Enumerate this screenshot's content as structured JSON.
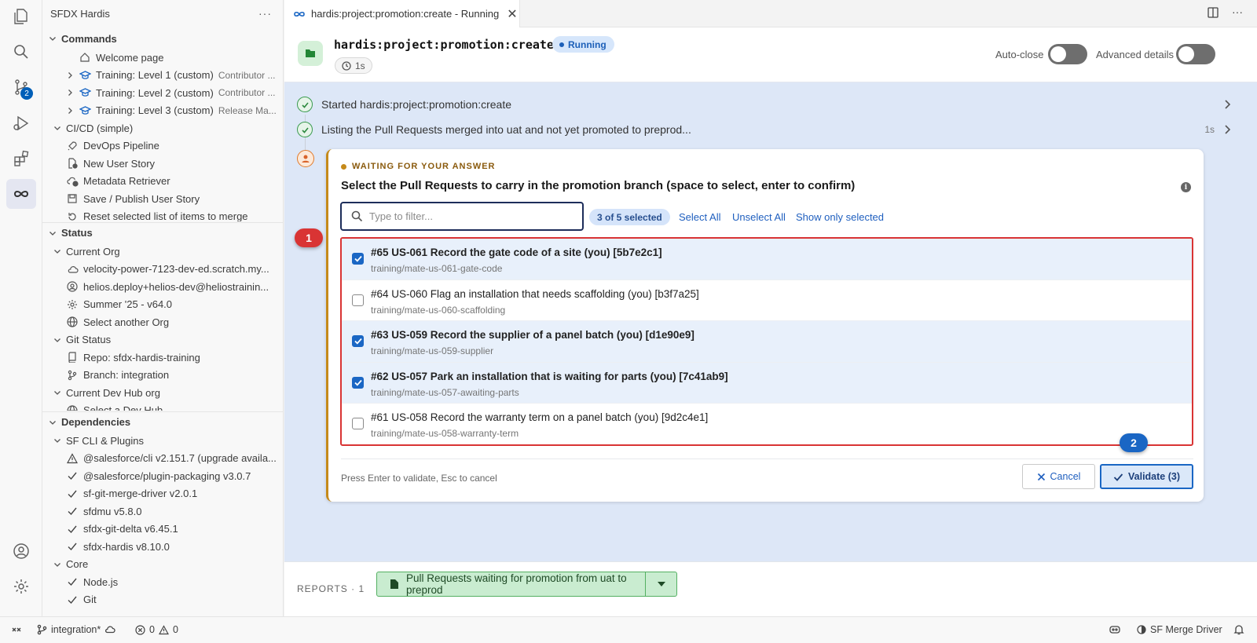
{
  "sidebar": {
    "title": "SFDX Hardis",
    "more": "···",
    "commands": {
      "header": "Commands",
      "items": [
        {
          "label": "Welcome page",
          "desc": "",
          "icon": "home-icon",
          "level": 2,
          "chevron": false
        },
        {
          "label": "Training: Level 1 (custom)",
          "desc": "Contributor ...",
          "icon": "graduation-icon",
          "level": 1,
          "chevron": true
        },
        {
          "label": "Training: Level 2 (custom)",
          "desc": "Contributor ...",
          "icon": "graduation-icon",
          "level": 1,
          "chevron": true
        },
        {
          "label": "Training: Level 3 (custom)",
          "desc": "Release Ma...",
          "icon": "graduation-icon",
          "level": 1,
          "chevron": true
        },
        {
          "label": "CI/CD (simple)",
          "desc": "",
          "icon": "",
          "level": 0,
          "chevron": true,
          "expanded": true
        },
        {
          "label": "DevOps Pipeline",
          "desc": "",
          "icon": "rocket-icon",
          "level": 1
        },
        {
          "label": "New User Story",
          "desc": "",
          "icon": "new-file-icon",
          "level": 1
        },
        {
          "label": "Metadata Retriever",
          "desc": "",
          "icon": "cloud-download-icon",
          "level": 1
        },
        {
          "label": "Save / Publish User Story",
          "desc": "",
          "icon": "save-icon",
          "level": 1
        },
        {
          "label": "Reset selected list of items to merge",
          "desc": "",
          "icon": "reset-icon",
          "level": 1
        }
      ]
    },
    "status": {
      "header": "Status",
      "items": [
        {
          "label": "Current Org",
          "icon": "",
          "level": 0,
          "chevron": true
        },
        {
          "label": "velocity-power-7123-dev-ed.scratch.my...",
          "icon": "cloud-icon",
          "level": 1
        },
        {
          "label": "helios.deploy+helios-dev@heliostrainin...",
          "icon": "account-icon",
          "level": 1
        },
        {
          "label": "Summer '25 - v64.0",
          "icon": "gear-icon",
          "level": 1
        },
        {
          "label": "Select another Org",
          "icon": "globe-icon",
          "level": 1
        },
        {
          "label": "Git Status",
          "icon": "",
          "level": 0,
          "chevron": true
        },
        {
          "label": "Repo: sfdx-hardis-training",
          "icon": "repo-icon",
          "level": 1
        },
        {
          "label": "Branch: integration",
          "icon": "branch-icon",
          "level": 1
        },
        {
          "label": "Current Dev Hub org",
          "icon": "",
          "level": 0,
          "chevron": true
        },
        {
          "label": "Select a Dev Hub",
          "icon": "globe-icon",
          "level": 1
        }
      ]
    },
    "dependencies": {
      "header": "Dependencies",
      "items": [
        {
          "label": "SF CLI & Plugins",
          "icon": "",
          "level": 0,
          "chevron": true
        },
        {
          "label": "@salesforce/cli v2.151.7 (upgrade availa...",
          "icon": "warning-icon",
          "level": 1
        },
        {
          "label": "@salesforce/plugin-packaging v3.0.7",
          "icon": "check-icon",
          "level": 1
        },
        {
          "label": "sf-git-merge-driver v2.0.1",
          "icon": "check-icon",
          "level": 1
        },
        {
          "label": "sfdmu v5.8.0",
          "icon": "check-icon",
          "level": 1
        },
        {
          "label": "sfdx-git-delta v6.45.1",
          "icon": "check-icon",
          "level": 1
        },
        {
          "label": "sfdx-hardis v8.10.0",
          "icon": "check-icon",
          "level": 1
        },
        {
          "label": "Core",
          "icon": "",
          "level": 0,
          "chevron": true
        },
        {
          "label": "Node.js",
          "icon": "check-icon",
          "level": 1
        },
        {
          "label": "Git",
          "icon": "check-icon",
          "level": 1
        }
      ]
    }
  },
  "activity": {
    "scm_badge": "2"
  },
  "tab": {
    "title": "hardis:project:promotion:create - Running",
    "close": "✕"
  },
  "header": {
    "command": "hardis:project:promotion:create",
    "status": "Running",
    "elapsed": "1s",
    "auto_close_label": "Auto-close",
    "advanced_label": "Advanced details"
  },
  "steps": [
    {
      "label": "Started hardis:project:promotion:create",
      "duration": ""
    },
    {
      "label": "Listing the Pull Requests merged into uat and not yet promoted to preprod...",
      "duration": "1s"
    }
  ],
  "prompt": {
    "waiting_label": "WAITING FOR YOUR ANSWER",
    "question": "Select the Pull Requests to carry in the promotion branch (space to select, enter to confirm)",
    "filter_placeholder": "Type to filter...",
    "selected_count": "3 of 5 selected",
    "select_all": "Select All",
    "unselect_all": "Unselect All",
    "show_selected": "Show only selected",
    "items": [
      {
        "title": "#65 US-061 Record the gate code of a site (you) [5b7e2c1]",
        "branch": "training/mate-us-061-gate-code",
        "selected": true
      },
      {
        "title": "#64 US-060 Flag an installation that needs scaffolding (you) [b3f7a25]",
        "branch": "training/mate-us-060-scaffolding",
        "selected": false
      },
      {
        "title": "#63 US-059 Record the supplier of a panel batch (you) [d1e90e9]",
        "branch": "training/mate-us-059-supplier",
        "selected": true
      },
      {
        "title": "#62 US-057 Park an installation that is waiting for parts (you) [7c41ab9]",
        "branch": "training/mate-us-057-awaiting-parts",
        "selected": true
      },
      {
        "title": "#61 US-058 Record the warranty term on a panel batch (you) [9d2c4e1]",
        "branch": "training/mate-us-058-warranty-term",
        "selected": false
      }
    ],
    "hint": "Press Enter to validate, Esc to cancel",
    "cancel_label": "Cancel",
    "validate_label": "Validate (3)"
  },
  "markers": {
    "one": "1",
    "two": "2"
  },
  "reports": {
    "label": "REPORTS · 1",
    "button": "Pull Requests waiting for promotion from uat to preprod"
  },
  "statusbar": {
    "branch": "integration*",
    "errors": "0",
    "warnings": "0",
    "merge_driver": "SF Merge Driver"
  },
  "colors": {
    "accent": "#1a66c4",
    "highlight_red": "#d93434",
    "waiting": "#c58a1a",
    "success": "#3b9b4f"
  }
}
